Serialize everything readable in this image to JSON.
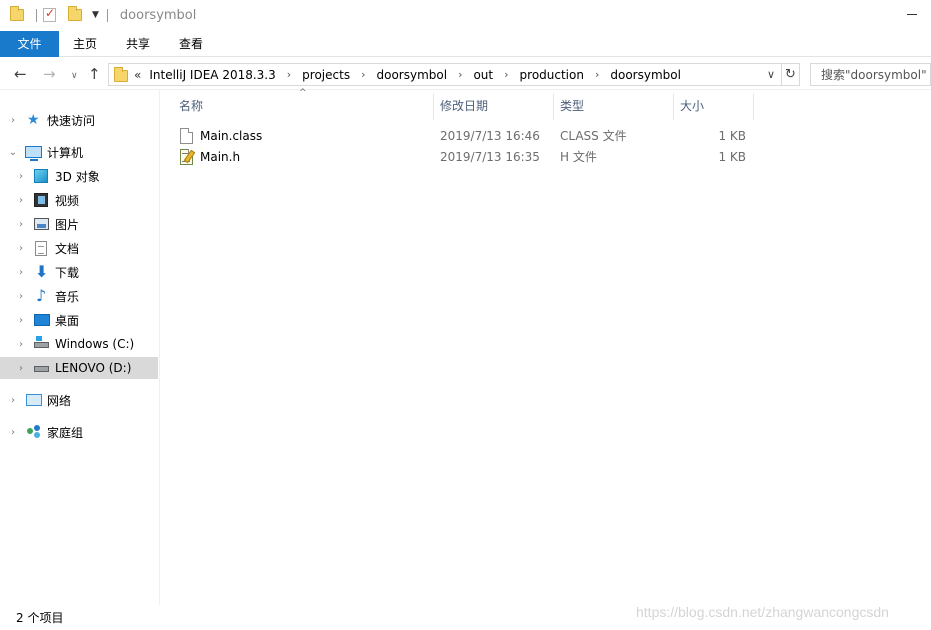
{
  "window": {
    "title": "doorsymbol"
  },
  "ribbon": {
    "tabs": [
      {
        "label": "文件",
        "active": true
      },
      {
        "label": "主页"
      },
      {
        "label": "共享"
      },
      {
        "label": "查看"
      }
    ]
  },
  "address": {
    "overflow_label": "«",
    "segments": [
      "IntelliJ IDEA 2018.3.3",
      "projects",
      "doorsymbol",
      "out",
      "production",
      "doorsymbol"
    ]
  },
  "search": {
    "placeholder": "搜索\"doorsymbol\""
  },
  "sidebar": {
    "items": [
      {
        "label": "快速访问",
        "icon": "star-icon"
      },
      {
        "label": "计算机",
        "icon": "computer-icon"
      },
      {
        "label": "3D 对象",
        "icon": "3d-objects-icon"
      },
      {
        "label": "视频",
        "icon": "video-icon"
      },
      {
        "label": "图片",
        "icon": "pictures-icon"
      },
      {
        "label": "文档",
        "icon": "documents-icon"
      },
      {
        "label": "下载",
        "icon": "download-icon"
      },
      {
        "label": "音乐",
        "icon": "music-icon"
      },
      {
        "label": "桌面",
        "icon": "desktop-icon"
      },
      {
        "label": "Windows (C:)",
        "icon": "drive-c-icon"
      },
      {
        "label": "LENOVO (D:)",
        "icon": "drive-d-icon",
        "selected": true
      },
      {
        "label": "网络",
        "icon": "network-icon"
      },
      {
        "label": "家庭组",
        "icon": "homegroup-icon"
      }
    ]
  },
  "columns": {
    "name": "名称",
    "modified": "修改日期",
    "type": "类型",
    "size": "大小"
  },
  "files": [
    {
      "name": "Main.class",
      "modified": "2019/7/13 16:46",
      "type": "CLASS 文件",
      "size": "1 KB",
      "icon": "file-icon"
    },
    {
      "name": "Main.h",
      "modified": "2019/7/13 16:35",
      "type": "H 文件",
      "size": "1 KB",
      "icon": "header-file-icon"
    }
  ],
  "status": {
    "item_count": "2 个项目"
  },
  "watermark": "https://blog.csdn.net/zhangwancongcsdn",
  "colors": {
    "accent": "#1979ca",
    "selected_bg": "#d9d9d9",
    "header_text": "#4c607a"
  }
}
